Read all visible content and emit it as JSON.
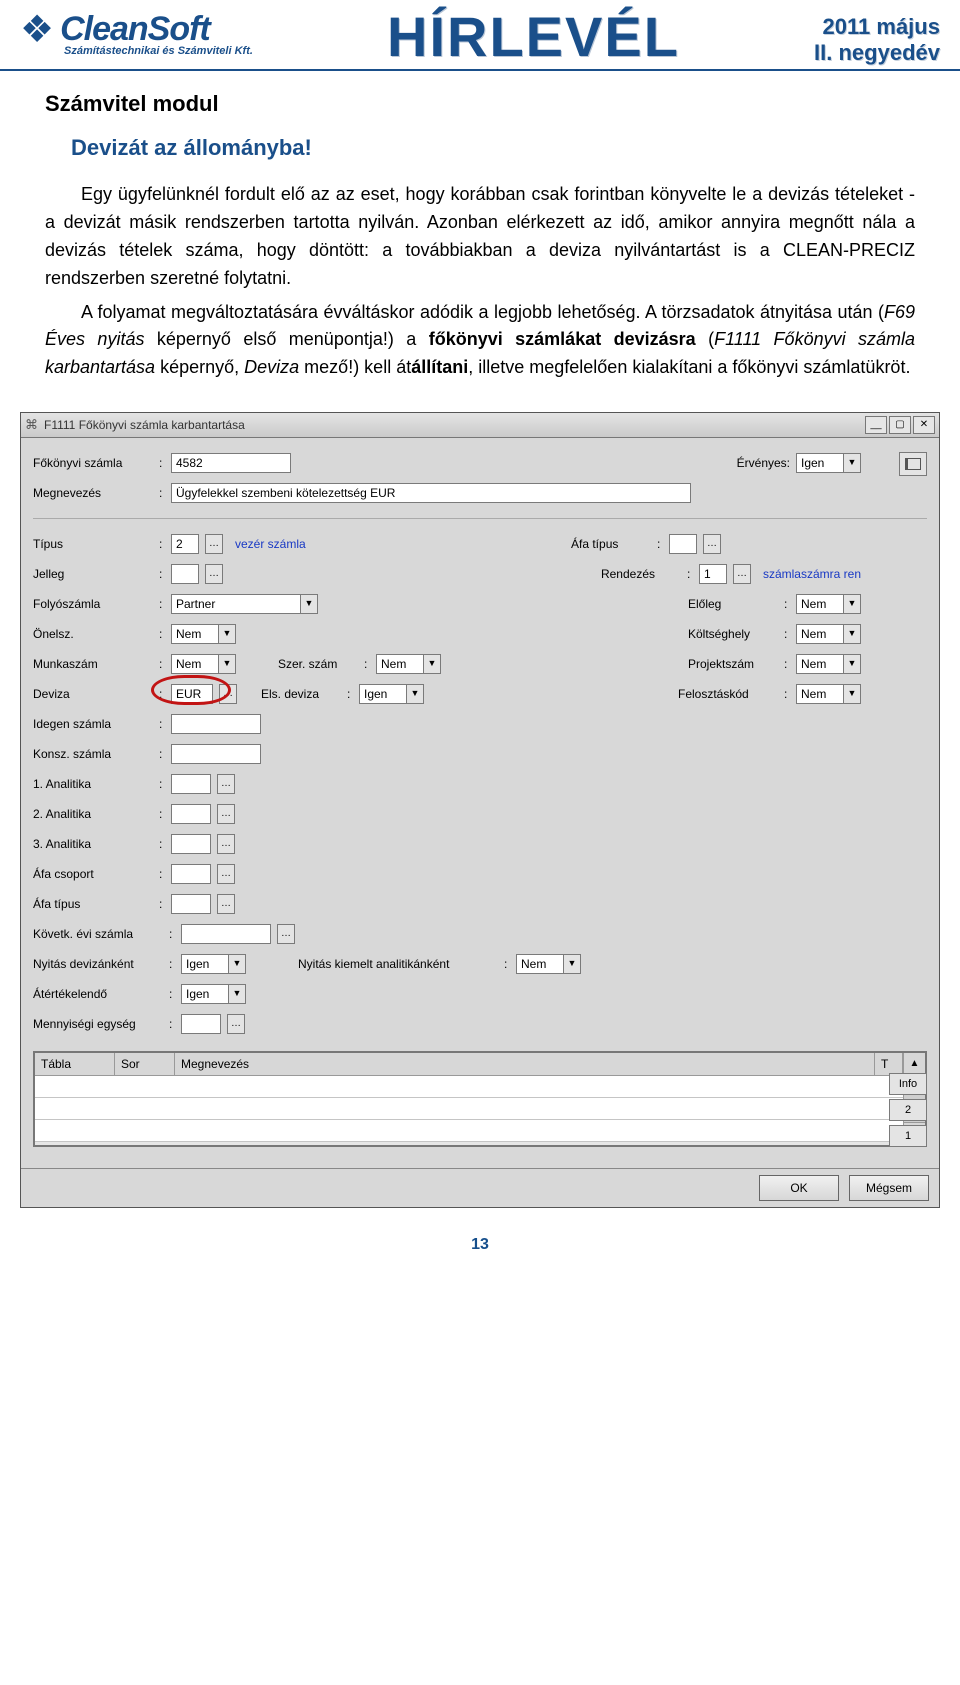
{
  "header": {
    "logo_name": "CleanSoft",
    "logo_sub": "Számítástechnikai és Számviteli Kft.",
    "center_title": "HÍRLEVÉL",
    "date_line1": "2011 május",
    "date_line2": "II. negyedév"
  },
  "article": {
    "section": "Számvitel modul",
    "title": "Devizát az állományba!",
    "p1_a": "Egy ügyfelünknél fordult elő az az eset, hogy korábban csak forintban könyvelte le a devizás tételeket  - a devizát másik rendszerben tartotta nyilván. Azonban elérkezett az idő, amikor annyira megnőtt nála a devizás tételek száma, hogy döntött: a továbbiakban a deviza nyilvántartást is a CLEAN-PRECIZ rendszerben szeretné folytatni.",
    "p1_b1": "A folyamat megváltoztatására évváltáskor adódik a legjobb lehetőség. A törzsadatok átnyitása után (",
    "p1_b2": "F69 Éves nyitás",
    "p1_b3": " képernyő első menüpontja!) a ",
    "p1_b4": "főkönyvi számlákat devizásra",
    "p1_b5": " (",
    "p1_b6": "F1111 Főkönyvi számla karbantartása",
    "p1_b7": " képernyő, ",
    "p1_b8": "Deviza",
    "p1_b9": " mező!) kell át",
    "p1_b10": "állítani",
    "p1_b11": ", illetve megfelelően kialakítani a főkönyvi számlatükröt."
  },
  "window": {
    "title": "F1111 Főkönyvi számla karbantartása",
    "labels": {
      "fokonyvi_szamla": "Főkönyvi számla",
      "ervenyes": "Érvényes:",
      "megnevezes": "Megnevezés",
      "tipus": "Típus",
      "afa_tipus": "Áfa típus",
      "jelleg": "Jelleg",
      "rendezes": "Rendezés",
      "folyoszamla": "Folyószámla",
      "eloleg": "Előleg",
      "onelsz": "Önelsz.",
      "koltseghely": "Költséghely",
      "munkaszam": "Munkaszám",
      "szer_szam": "Szer. szám",
      "projektszam": "Projektszám",
      "deviza": "Deviza",
      "els_deviza": "Els. deviza",
      "felosztaskod": "Felosztáskód",
      "idegen_szamla": "Idegen számla",
      "konsz_szamla": "Konsz. számla",
      "an1": "1. Analitika",
      "an2": "2. Analitika",
      "an3": "3. Analitika",
      "afa_csoport": "Áfa csoport",
      "afa_tipus2": "Áfa típus",
      "kovetk": "Követk. évi számla",
      "nyitas_dev": "Nyitás devizánként",
      "nyitas_an": "Nyitás kiemelt analitikánként",
      "atertekelendo": "Átértékelendő",
      "mennyisegi": "Mennyiségi egység"
    },
    "values": {
      "fokonyvi_szamla": "4582",
      "ervenyes": "Igen",
      "megnevezes": "Ügyfelekkel szembeni kötelezettség EUR",
      "tipus": "2",
      "tipus_aux": "vezér számla",
      "afa_tipus": "",
      "jelleg": "",
      "rendezes": "1",
      "rendezes_aux": "számlaszámra ren",
      "folyoszamla": "Partner",
      "eloleg": "Nem",
      "onelsz": "Nem",
      "koltseghely": "Nem",
      "munkaszam": "Nem",
      "szer_szam": "Nem",
      "projektszam": "Nem",
      "deviza": "EUR",
      "els_deviza": "Igen",
      "felosztaskod": "Nem",
      "idegen_szamla": "",
      "konsz_szamla": "",
      "an1": "",
      "an2": "",
      "an3": "",
      "afa_csoport": "",
      "afa_tipus2": "",
      "kovetk": "",
      "nyitas_dev": "Igen",
      "nyitas_an": "Nem",
      "atertekelendo": "Igen",
      "mennyisegi": ""
    },
    "grid": {
      "headers": {
        "tabla": "Tábla",
        "sor": "Sor",
        "megnevezes": "Megnevezés",
        "t": "T"
      },
      "side": {
        "info": "Info",
        "b2": "2",
        "b1": "1"
      }
    },
    "buttons": {
      "ok": "OK",
      "cancel": "Mégsem"
    }
  },
  "page_number": "13"
}
